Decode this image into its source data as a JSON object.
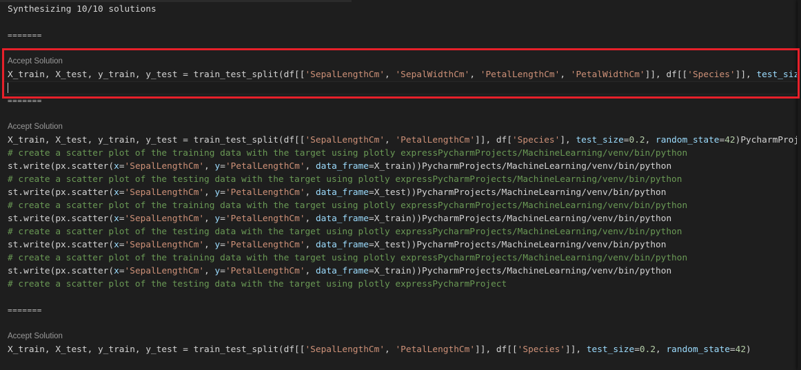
{
  "header": {
    "status": "Synthesizing 10/10 solutions"
  },
  "separator": "=======",
  "solutions": [
    {
      "accept_label": "Accept Solution",
      "lines": [
        "X_train, X_test, y_train, y_test = train_test_split(df[['SepalLengthCm', 'SepalWidthCm', 'PetalLengthCm', 'PetalWidthCm']], df[['Species']], test_siz"
      ],
      "selected": true
    },
    {
      "accept_label": "Accept Solution",
      "lines": [
        "X_train, X_test, y_train, y_test = train_test_split(df[['SepalLengthCm', 'PetalLengthCm']], df['Species'], test_size=0.2, random_state=42)PycharmProj",
        "# create a scatter plot of the training data with the target using plotly expressPycharmProjects/MachineLearning/venv/bin/python",
        "st.write(px.scatter(x='SepalLengthCm', y='PetalLengthCm', data_frame=X_train))PycharmProjects/MachineLearning/venv/bin/python",
        "# create a scatter plot of the testing data with the target using plotly expressPycharmProjects/MachineLearning/venv/bin/python",
        "st.write(px.scatter(x='SepalLengthCm', y='PetalLengthCm', data_frame=X_test))PycharmProjects/MachineLearning/venv/bin/python",
        "# create a scatter plot of the training data with the target using plotly expressPycharmProjects/MachineLearning/venv/bin/python",
        "st.write(px.scatter(x='SepalLengthCm', y='PetalLengthCm', data_frame=X_train))PycharmProjects/MachineLearning/venv/bin/python",
        "# create a scatter plot of the testing data with the target using plotly expressPycharmProjects/MachineLearning/venv/bin/python",
        "st.write(px.scatter(x='SepalLengthCm', y='PetalLengthCm', data_frame=X_test))PycharmProjects/MachineLearning/venv/bin/python",
        "# create a scatter plot of the training data with the target using plotly expressPycharmProjects/MachineLearning/venv/bin/python",
        "st.write(px.scatter(x='SepalLengthCm', y='PetalLengthCm', data_frame=X_train))PycharmProjects/MachineLearning/venv/bin/python",
        "# create a scatter plot of the testing data with the target using plotly expressPycharmProject"
      ],
      "selected": false
    },
    {
      "accept_label": "Accept Solution",
      "lines": [
        "X_train, X_test, y_train, y_test = train_test_split(df[['SepalLengthCm', 'PetalLengthCm']], df[['Species']], test_size=0.2, random_state=42)"
      ],
      "selected": false
    }
  ],
  "colors": {
    "highlight_border": "#e8202a",
    "string": "#ce9178",
    "param": "#9cdcfe",
    "number": "#b5cea8",
    "comment": "#6a9955",
    "text": "#d4d4d4"
  }
}
